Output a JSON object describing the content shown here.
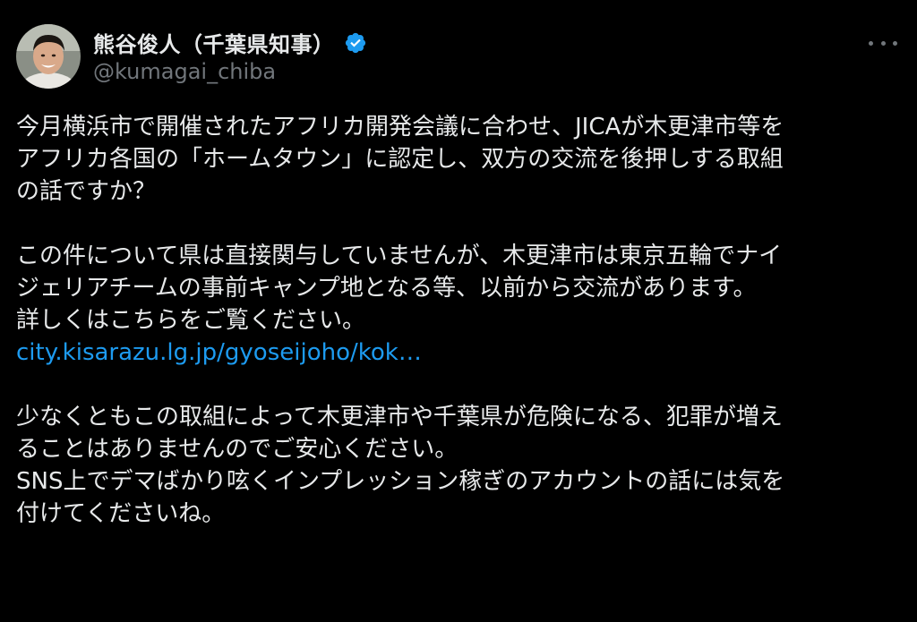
{
  "author": {
    "display_name": "熊谷俊人（千葉県知事）",
    "handle": "@kumagai_chiba",
    "avatar_icon": "person-portrait",
    "verified_icon": "verified-badge-icon",
    "verified_color": "#1d9bf0"
  },
  "post": {
    "paragraph1": [
      "今月横浜市で開催されたアフリカ開発会議に合わせ、JICAが木更津市等を",
      "アフリカ各国の「ホームタウン」に認定し、双方の交流を後押しする取組",
      "の話ですか？"
    ],
    "paragraph2": [
      "この件について県は直接関与していませんが、木更津市は東京五輪でナイ",
      "ジェリアチームの事前キャンプ地となる等、以前から交流があります。",
      "詳しくはこちらをご覧ください。"
    ],
    "link_text": "city.kisarazu.lg.jp/gyoseijoho/kok…",
    "paragraph3": [
      "少なくともこの取組によって木更津市や千葉県が危険になる、犯罪が増え",
      "ることはありませんのでご安心ください。",
      "SNS上でデマばかり呟くインプレッション稼ぎのアカウントの話には気を",
      "付けてくださいね。"
    ]
  },
  "colors": {
    "background": "#000000",
    "text": "#e7e9ea",
    "secondary": "#71767b",
    "link": "#1d9bf0"
  }
}
